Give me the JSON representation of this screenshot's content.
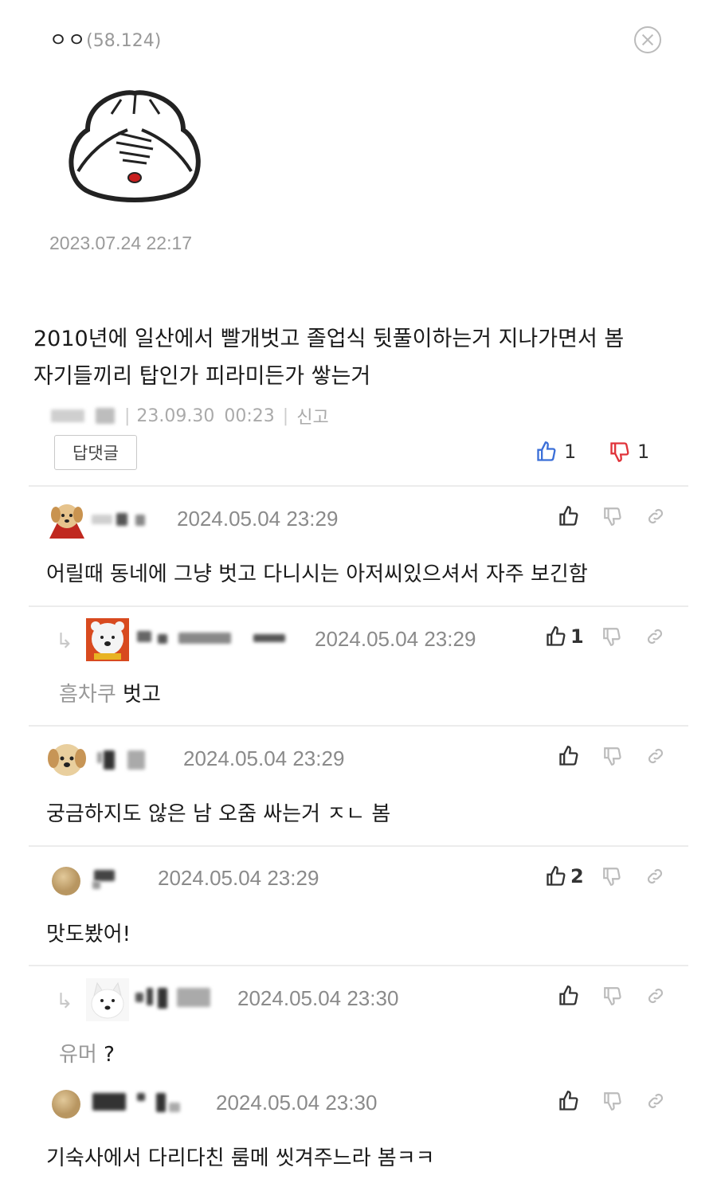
{
  "post": {
    "author": "ㅇㅇ",
    "ip": "(58.124)",
    "date": "2023.07.24 22:17",
    "body_line1": "2010년에 일산에서 빨개벗고 졸업식 뒷풀이하는거 지나가면서 봄",
    "body_line2": "자기들끼리 탑인가 피라미든가 쌓는거",
    "meta_date": "23.09.30",
    "meta_time": "00:23",
    "report_label": "신고",
    "reply_label": "답댓글",
    "up_count": "1",
    "down_count": "1",
    "colors": {
      "up": "#3b6fd8",
      "down": "#e0333a"
    }
  },
  "comments": [
    {
      "date": "2024.05.04 23:29",
      "text": "어릴때 동네에 그냥 벗고 다니시는 아저씨있으셔서 자주 보긴함",
      "likes": "",
      "reply": false,
      "avatar": "puppy-cape-avatar"
    },
    {
      "date": "2024.05.04 23:29",
      "prefix": "흠차쿠",
      "text": "벗고",
      "likes": "1",
      "reply": true,
      "avatar": "polar-bear-avatar"
    },
    {
      "date": "2024.05.04 23:29",
      "text": "궁금하지도 않은 남 오줌 싸는거 ㅈㄴ 봄",
      "likes": "",
      "reply": false,
      "avatar": "puppy-face-avatar"
    },
    {
      "date": "2024.05.04 23:29",
      "text": "맛도봤어!",
      "likes": "2",
      "reply": false,
      "avatar": "beige-circle-avatar"
    },
    {
      "date": "2024.05.04 23:30",
      "prefix": "유머",
      "text": "?",
      "likes": "",
      "reply": true,
      "avatar": "white-dog-avatar"
    },
    {
      "date": "2024.05.04 23:30",
      "text": "기숙사에서 다리다친 룸메 씻겨주느라 봄ㅋㅋ",
      "likes": "",
      "reply": false,
      "avatar": "beige-circle-avatar"
    }
  ]
}
